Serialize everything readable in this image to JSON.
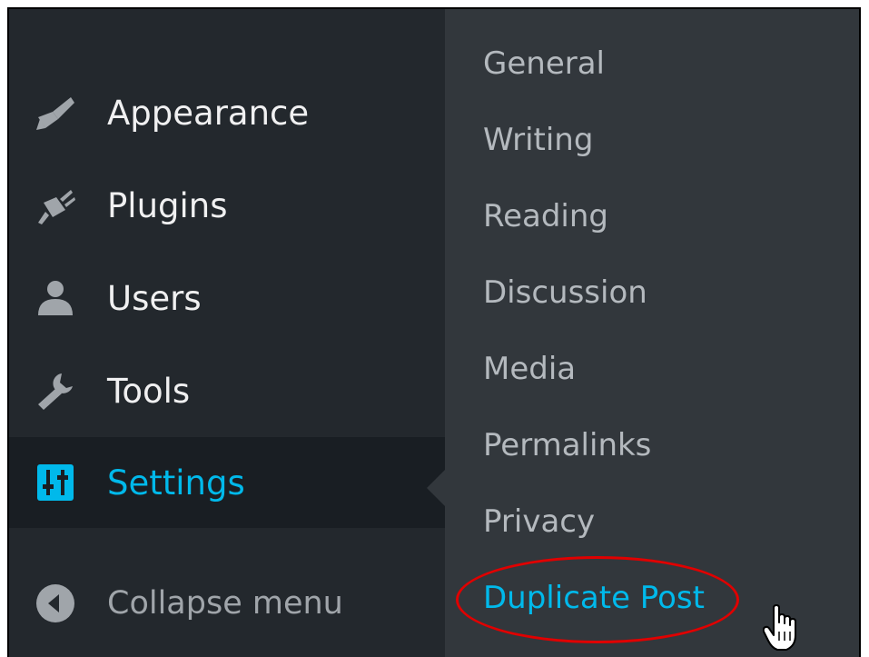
{
  "sidebar": {
    "items": [
      {
        "label": "Appearance",
        "icon": "paintbrush-icon"
      },
      {
        "label": "Plugins",
        "icon": "plugin-icon"
      },
      {
        "label": "Users",
        "icon": "user-icon"
      },
      {
        "label": "Tools",
        "icon": "wrench-icon"
      },
      {
        "label": "Settings",
        "icon": "settings-sliders-icon",
        "active": true
      }
    ],
    "collapse_label": "Collapse menu"
  },
  "submenu": {
    "items": [
      {
        "label": "General"
      },
      {
        "label": "Writing"
      },
      {
        "label": "Reading"
      },
      {
        "label": "Discussion"
      },
      {
        "label": "Media"
      },
      {
        "label": "Permalinks"
      },
      {
        "label": "Privacy"
      },
      {
        "label": "Duplicate Post",
        "highlighted": true
      }
    ]
  },
  "colors": {
    "sidebar_bg": "#23282d",
    "submenu_bg": "#32373c",
    "active_bg": "#191e23",
    "accent": "#00b9eb",
    "annotation": "#e00000"
  }
}
